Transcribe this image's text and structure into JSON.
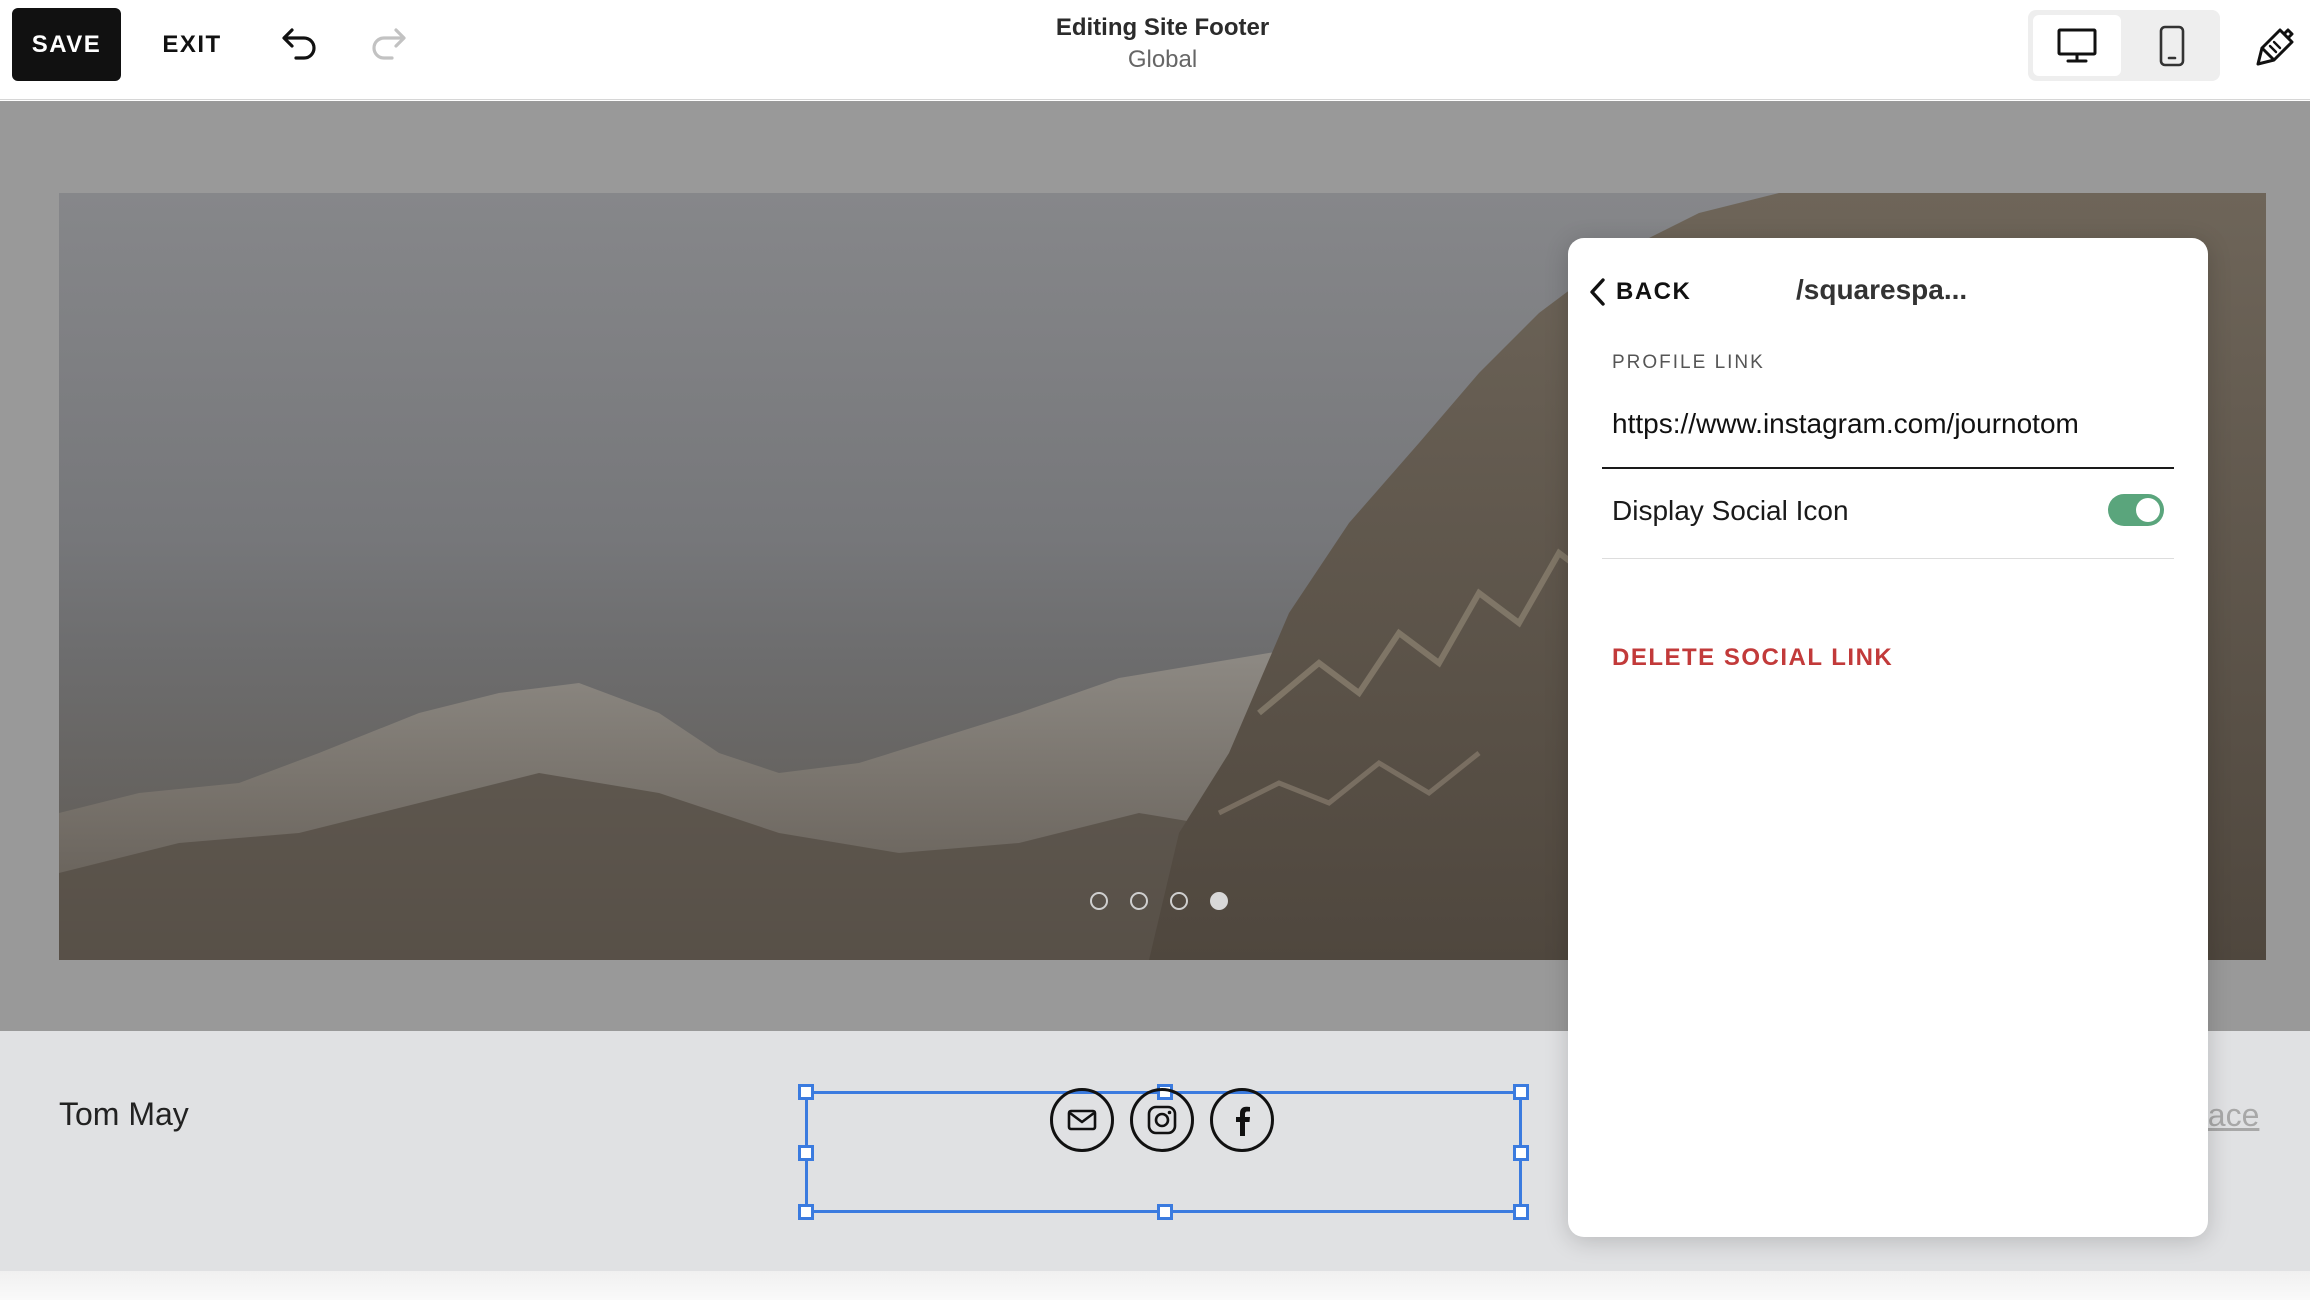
{
  "toolbar": {
    "save_label": "SAVE",
    "exit_label": "EXIT",
    "undo_icon": "undo-icon",
    "redo_icon": "redo-icon",
    "design_icon": "paintbrush-icon"
  },
  "header": {
    "title": "Editing Site Footer",
    "subtitle": "Global"
  },
  "device_toggle": {
    "options": [
      "desktop",
      "mobile"
    ],
    "selected": "desktop"
  },
  "hero": {
    "slide_dots_count": 4,
    "active_dot": 4
  },
  "footer": {
    "name": "Tom May",
    "right_text_partial": "pace",
    "social_icons": [
      "email-icon",
      "instagram-icon",
      "facebook-icon"
    ]
  },
  "panel": {
    "back_label": "BACK",
    "title": "/squarespa...",
    "profile_link_label": "PROFILE LINK",
    "profile_link_value": "https://www.instagram.com/journotom",
    "display_social_icon_label": "Display Social Icon",
    "display_social_icon_on": true,
    "delete_label": "DELETE SOCIAL LINK"
  },
  "colors": {
    "accent_selection": "#3b7bdf",
    "toggle_on": "#5aa57c",
    "delete_red": "#c23a3a",
    "save_bg": "#111111"
  }
}
